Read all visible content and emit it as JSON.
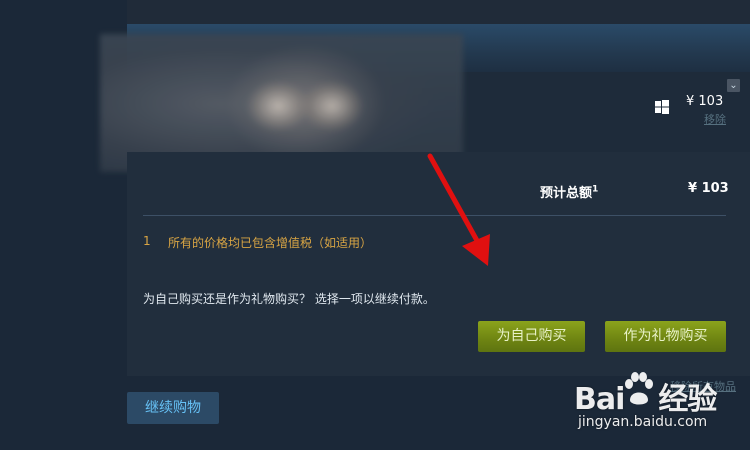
{
  "cart_item": {
    "price": "¥ 103",
    "remove_label": "移除",
    "platform_icon": "windows-icon",
    "collapse_icon": "chevron-down-icon"
  },
  "summary": {
    "total_label": "预计总额",
    "total_footnote_marker": "1",
    "total_value": "¥ 103",
    "footnote_number": "1",
    "footnote_text": "所有的价格均已包含增值税（如适用）",
    "choice_prompt": "为自己购买还是作为礼物购买？ 选择一项以继续付款。",
    "buy_for_self_label": "为自己购买",
    "buy_as_gift_label": "作为礼物购买"
  },
  "footer": {
    "remove_all_label": "移除所有物品",
    "continue_shopping_label": "继续购物"
  },
  "watermark": {
    "logo_text_left": "Bai",
    "logo_text_right": "经验",
    "url": "jingyan.baidu.com"
  },
  "colors": {
    "accent_green": "#8ba31c",
    "footnote_orange": "#d9a544",
    "arrow_red": "#e01010",
    "background": "#1b2838"
  }
}
